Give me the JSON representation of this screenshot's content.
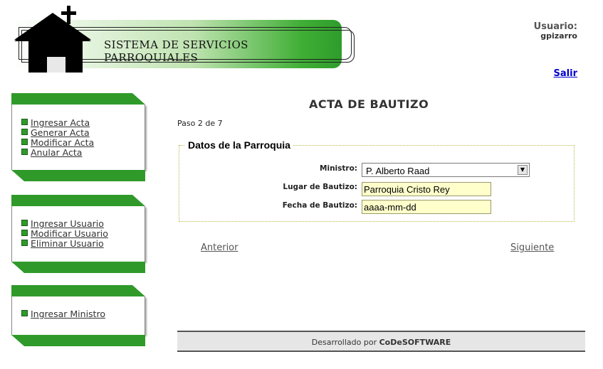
{
  "header": {
    "title": "SISTEMA DE SERVICIOS PARROQUIALES",
    "user_label": "Usuario:",
    "user_name": "gpizarro",
    "logout": "Salir"
  },
  "menus": [
    {
      "items": [
        "Ingresar Acta",
        "Generar Acta",
        "Modificar Acta",
        "Anular Acta"
      ]
    },
    {
      "items": [
        "Ingresar Usuario",
        "Modificar Usuario",
        "Eliminar Usuario"
      ]
    },
    {
      "items": [
        "Ingresar Ministro"
      ]
    }
  ],
  "main": {
    "title": "ACTA DE BAUTIZO",
    "step": "Paso 2 de 7",
    "section_title": "Datos de la Parroquia",
    "fields": {
      "ministro_label": "Ministro:",
      "ministro_value": "P. Alberto Raad",
      "lugar_label": "Lugar de Bautizo:",
      "lugar_value": "Parroquia Cristo Rey",
      "fecha_label": "Fecha de Bautizo:",
      "fecha_placeholder": "aaaa-mm-dd"
    },
    "prev": "Anterior",
    "next": "Siguiente"
  },
  "footer": {
    "prefix": "Desarrollado por ",
    "brand": "CoDeSOFTWARE"
  }
}
